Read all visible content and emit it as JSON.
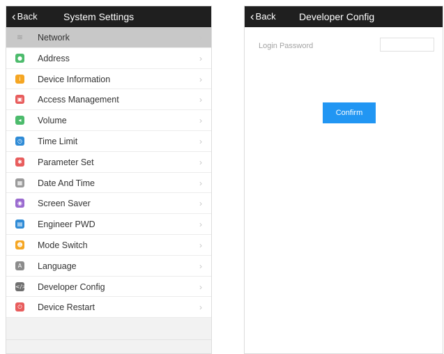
{
  "left_panel": {
    "back_label": "Back",
    "title": "System Settings",
    "items": [
      {
        "label": "Network",
        "icon": "wifi-icon",
        "color": "#c8c8c8",
        "glyph": "≋",
        "selected": true
      },
      {
        "label": "Address",
        "icon": "location-pin-icon",
        "color": "#4cbb6c",
        "glyph": "●"
      },
      {
        "label": "Device Information",
        "icon": "info-icon",
        "color": "#f5a623",
        "glyph": "i"
      },
      {
        "label": "Access Management",
        "icon": "door-icon",
        "color": "#e85d5d",
        "glyph": "▣"
      },
      {
        "label": "Volume",
        "icon": "speaker-icon",
        "color": "#4cbb6c",
        "glyph": "◂"
      },
      {
        "label": "Time Limit",
        "icon": "clock-icon",
        "color": "#2f8bd6",
        "glyph": "◷"
      },
      {
        "label": "Parameter Set",
        "icon": "gear-icon",
        "color": "#e85d5d",
        "glyph": "✱"
      },
      {
        "label": "Date And Time",
        "icon": "calendar-icon",
        "color": "#9a9a9a",
        "glyph": "▦"
      },
      {
        "label": "Screen Saver",
        "icon": "screensaver-icon",
        "color": "#9b6bd0",
        "glyph": "◉"
      },
      {
        "label": "Engineer PWD",
        "icon": "lock-icon",
        "color": "#2f8bd6",
        "glyph": "▤"
      },
      {
        "label": "Mode Switch",
        "icon": "user-switch-icon",
        "color": "#f5a623",
        "glyph": "☻"
      },
      {
        "label": "Language",
        "icon": "language-icon",
        "color": "#8c8c8c",
        "glyph": "A"
      },
      {
        "label": "Developer Config",
        "icon": "code-icon",
        "color": "#6f6f6f",
        "glyph": "</>"
      },
      {
        "label": "Device Restart",
        "icon": "power-icon",
        "color": "#e85d5d",
        "glyph": "⏻"
      }
    ],
    "arrow_glyph": "›"
  },
  "right_panel": {
    "back_label": "Back",
    "title": "Developer Config",
    "password_label": "Login Password",
    "password_value": "",
    "confirm_label": "Confirm",
    "confirm_color": "#2196f3"
  }
}
